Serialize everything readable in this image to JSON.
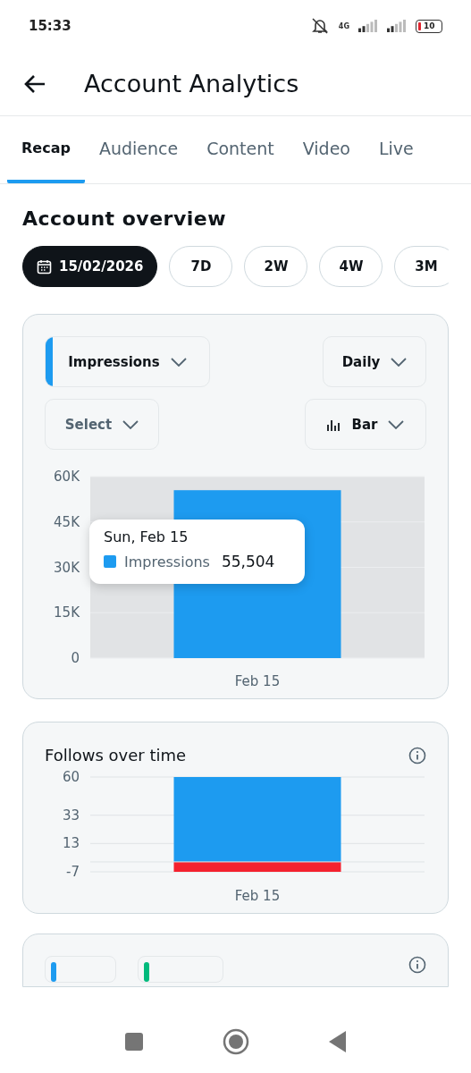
{
  "status_bar": {
    "time": "15:33",
    "network": "4G",
    "battery": "10"
  },
  "header": {
    "title": "Account Analytics"
  },
  "tabs": [
    {
      "label": "Recap",
      "selected": true
    },
    {
      "label": "Audience",
      "selected": false
    },
    {
      "label": "Content",
      "selected": false
    },
    {
      "label": "Video",
      "selected": false
    },
    {
      "label": "Live",
      "selected": false
    }
  ],
  "section_title": "Account overview",
  "ranges": [
    {
      "label": "15/02/2026",
      "kind": "date",
      "selected": true
    },
    {
      "label": "7D",
      "kind": "preset",
      "selected": false
    },
    {
      "label": "2W",
      "kind": "preset",
      "selected": false
    },
    {
      "label": "4W",
      "kind": "preset",
      "selected": false
    },
    {
      "label": "3M",
      "kind": "preset",
      "selected": false
    }
  ],
  "impressions_card": {
    "metric": {
      "label": "Impressions",
      "color": "#1d9bf0"
    },
    "interval": "Daily",
    "compare": {
      "placeholder": "Select"
    },
    "chart_type": "Bar",
    "chart_data": {
      "type": "bar",
      "categories": [
        "Feb 15"
      ],
      "series": [
        {
          "color": "#1d9bf0",
          "values": [
            55504
          ]
        }
      ],
      "ylim": [
        0,
        60000
      ],
      "grid": true,
      "yticks": [
        {
          "value": 0,
          "label": "0"
        },
        {
          "value": 15000,
          "label": "15K"
        },
        {
          "value": 30000,
          "label": "30K"
        },
        {
          "value": 45000,
          "label": "45K"
        },
        {
          "value": 60000,
          "label": "60K"
        }
      ]
    },
    "tooltip": {
      "date": "Sun, Feb 15",
      "series": "Impressions",
      "value": "55,504",
      "color": "#1d9bf0"
    }
  },
  "follows_card": {
    "title": "Follows over time",
    "chart_data": {
      "type": "bar",
      "stacked": true,
      "categories": [
        "Feb 15"
      ],
      "series": [
        {
          "color": "#1d9bf0",
          "values": [
            60
          ]
        },
        {
          "color": "#f4212e",
          "values": [
            -7
          ]
        }
      ],
      "ylim": [
        -7,
        60
      ],
      "grid": true,
      "yticks": [
        -7,
        13,
        33,
        60
      ]
    }
  },
  "next_card": {
    "chips": [
      {
        "color": "#1d9bf0"
      },
      {
        "color": "#00ba7c"
      }
    ]
  }
}
